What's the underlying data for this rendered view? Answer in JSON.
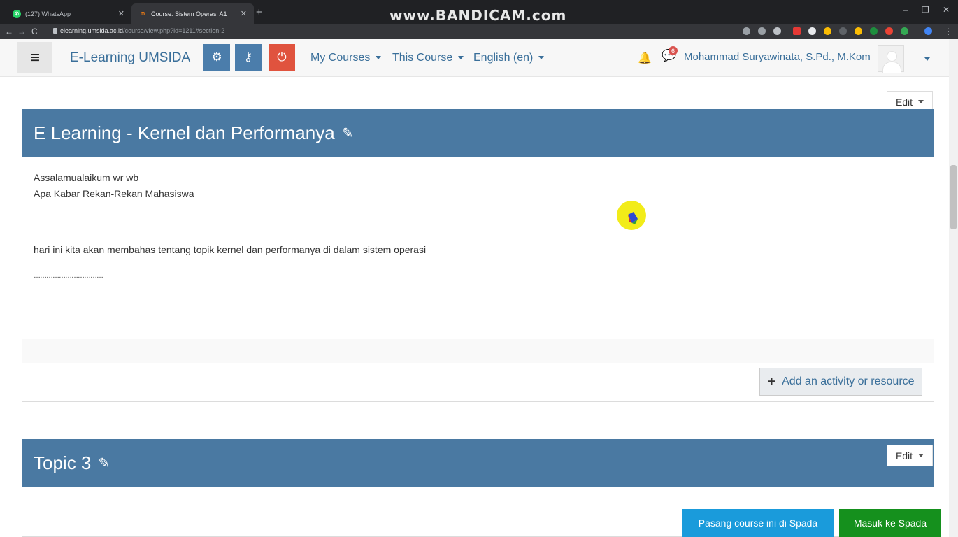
{
  "browser": {
    "tabs": [
      {
        "title": "(127) WhatsApp",
        "favicon": "whatsapp-icon",
        "favicon_color": "#25d366"
      },
      {
        "title": "Course: Sistem Operasi A1",
        "favicon": "moodle-icon",
        "favicon_color": "#f98012"
      }
    ],
    "watermark": "www.BANDICAM.com",
    "url_host": "elearning.umsida.ac.id",
    "url_path": "/course/view.php?id=1211#section-2"
  },
  "navbar": {
    "brand": "E-Learning UMSIDA",
    "menus": [
      "My Courses",
      "This Course",
      "English (en)"
    ],
    "message_count": "6",
    "user_name": "Mohammad Suryawinata, S.Pd., M.Kom"
  },
  "section2": {
    "edit_label": "Edit",
    "title": "E Learning - Kernel dan Performanya",
    "summary": [
      "Assalamualaikum wr wb",
      "Apa Kabar Rekan-Rekan Mahasiswa",
      "hari ini kita akan membahas tentang topik kernel dan performanya di dalam sistem operasi",
      "……………………………"
    ],
    "add_label": "Add an activity or resource"
  },
  "section3": {
    "edit_label": "Edit",
    "title": "Topic 3"
  },
  "footer_buttons": {
    "spada_install": "Pasang course ini di Spada",
    "spada_enter": "Masuk ke Spada"
  },
  "colors": {
    "section_header": "#4a79a2",
    "brand_text": "#3a6f9a",
    "spada_blue": "#1a9bdb",
    "spada_green": "#15901d"
  }
}
